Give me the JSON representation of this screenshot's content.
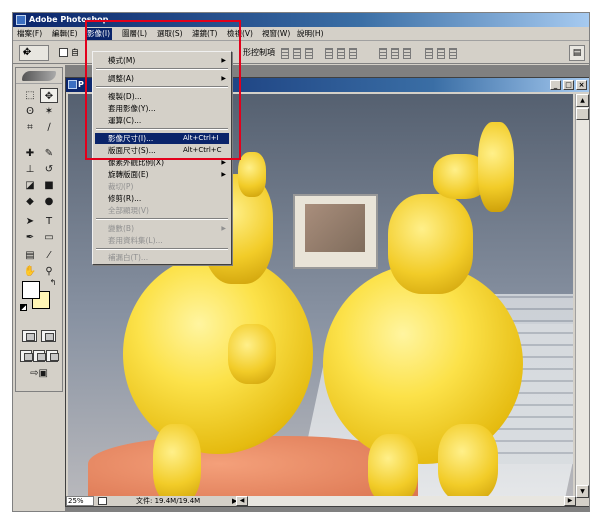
{
  "app": {
    "title": "Adobe Photoshop",
    "menu": [
      "檔案(F)",
      "編輯(E)",
      "影像(I)",
      "圖層(L)",
      "選取(S)",
      "濾鏡(T)",
      "檢視(V)",
      "視窗(W)",
      "說明(H)"
    ],
    "active_menu_index": 2
  },
  "options_bar": {
    "check_label": "自",
    "transform_label": "形控制項"
  },
  "document": {
    "title": "P",
    "zoom": "25%",
    "doc_size": "文件: 19.4M/19.4M"
  },
  "image_menu": {
    "items": [
      {
        "label": "模式(M)",
        "submenu": true,
        "disabled": false
      },
      {
        "label": "調整(A)",
        "submenu": true,
        "disabled": false
      },
      {
        "label": "複製(D)...",
        "disabled": false
      },
      {
        "label": "套用影像(Y)...",
        "disabled": false
      },
      {
        "label": "運算(C)...",
        "disabled": false
      },
      {
        "label": "影像尺寸(I)...",
        "shortcut": "Alt+Ctrl+I",
        "highlighted": true,
        "disabled": false
      },
      {
        "label": "版面尺寸(S)...",
        "shortcut": "Alt+Ctrl+C",
        "disabled": false
      },
      {
        "label": "像素外觀比例(X)",
        "submenu": true,
        "disabled": false
      },
      {
        "label": "旋轉版面(E)",
        "submenu": true,
        "disabled": false
      },
      {
        "label": "裁切(P)",
        "disabled": true
      },
      {
        "label": "修剪(R)...",
        "disabled": false
      },
      {
        "label": "全部顯現(V)",
        "disabled": true
      },
      {
        "label": "變數(B)",
        "submenu": true,
        "disabled": true
      },
      {
        "label": "套用資料集(L)...",
        "disabled": true
      },
      {
        "label": "補漏白(T)...",
        "disabled": true
      }
    ]
  },
  "colors": {
    "title_blue": "#0a246a",
    "highlight_red": "#e3001b",
    "foreground_swatch": "#ffffff",
    "background_swatch": "#fff5b5"
  },
  "icons": [
    "photoshop-logo-icon",
    "move-tool-icon",
    "marquee-tool-icon",
    "lasso-tool-icon",
    "crop-tool-icon",
    "brush-tool-icon",
    "type-tool-icon",
    "hand-tool-icon",
    "zoom-tool-icon"
  ]
}
